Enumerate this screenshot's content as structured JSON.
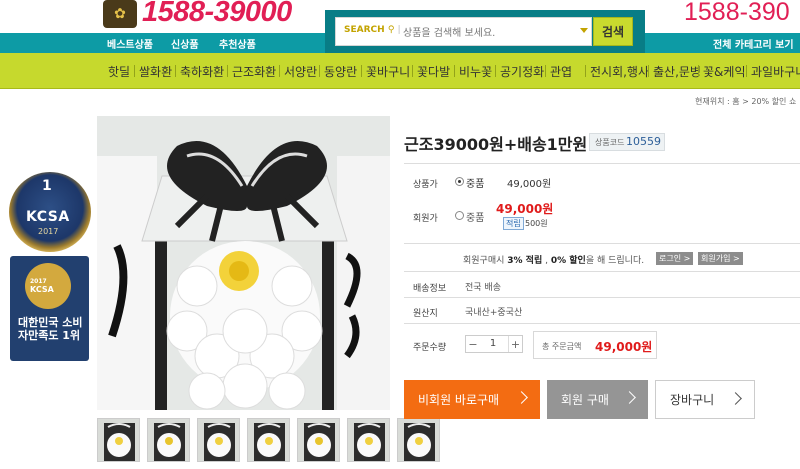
{
  "header": {
    "logo_phone": "1588-39000",
    "right_phone": "1588-390",
    "teal_nav": [
      "베스트상품",
      "신상품",
      "추천상품"
    ],
    "search": {
      "label": "SEARCH",
      "placeholder": "상품을 검색해 보세요.",
      "button": "검색"
    },
    "all_categories": "전체 카테고리 보기"
  },
  "categories": [
    "핫딜",
    "쌀화환",
    "축하화환",
    "근조화환",
    "서양란",
    "동양란",
    "꽃바구니",
    "꽃다발",
    "비누꽃",
    "공기정화",
    "관엽",
    "전시회,행사",
    "출산,문병",
    "꽃&케익",
    "과일바구니"
  ],
  "breadcrumb": "현재위치 : 홈 > 20% 할인 쇼",
  "badges": {
    "medal": {
      "number": "1",
      "name": "KCSA",
      "year": "2017"
    },
    "award": {
      "year": "2017",
      "name": "KCSA",
      "text": "대한민국 소비자만족도 1위"
    }
  },
  "product": {
    "title": "근조39000원+배송1만원",
    "code_label": "상품코드",
    "code": "10559",
    "price_label": "상품가",
    "price_option": "중품",
    "price": "49,000원",
    "member_label": "회원가",
    "member_option": "중품",
    "member_price": "49,000원",
    "point_badge": "적립",
    "point": "500원",
    "member_msg_pre": "회원구매시 ",
    "member_msg_b1": "3% 적립",
    "member_msg_mid": " , ",
    "member_msg_b2": "0% 할인",
    "member_msg_post": "을 해 드립니다.",
    "login_btn": "로그인 >",
    "join_btn": "회원가입 >",
    "ship_label": "배송정보",
    "ship_value": "전국 배송",
    "origin_label": "원산지",
    "origin_value": "국내산+중국산",
    "qty_label": "주문수량",
    "qty": "1",
    "total_label": "총 주문금액",
    "total": "49,000원"
  },
  "buttons": {
    "guest": "비회원 바로구매",
    "member": "회원 구매",
    "cart": "장바구니"
  },
  "thumbnails": 7
}
